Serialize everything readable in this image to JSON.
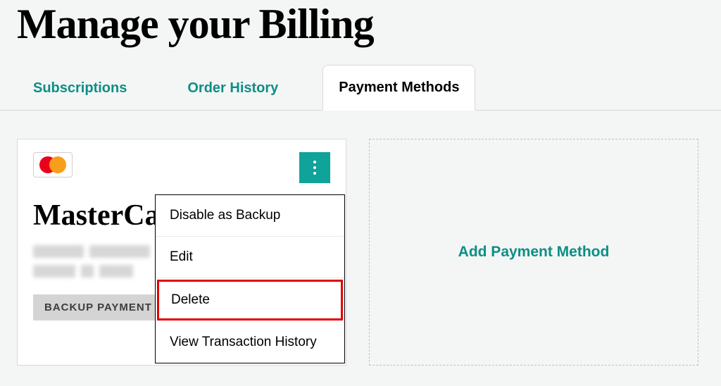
{
  "page": {
    "title": "Manage your Billing"
  },
  "tabs": {
    "subscriptions": "Subscriptions",
    "order_history": "Order History",
    "payment_methods": "Payment Methods"
  },
  "payment_card": {
    "brand": "MasterCard",
    "badge_label": "BACKUP PAYMENT"
  },
  "dropdown": {
    "disable_backup": "Disable as Backup",
    "edit": "Edit",
    "delete": "Delete",
    "view_history": "View Transaction History"
  },
  "add_card": {
    "label": "Add Payment Method"
  }
}
